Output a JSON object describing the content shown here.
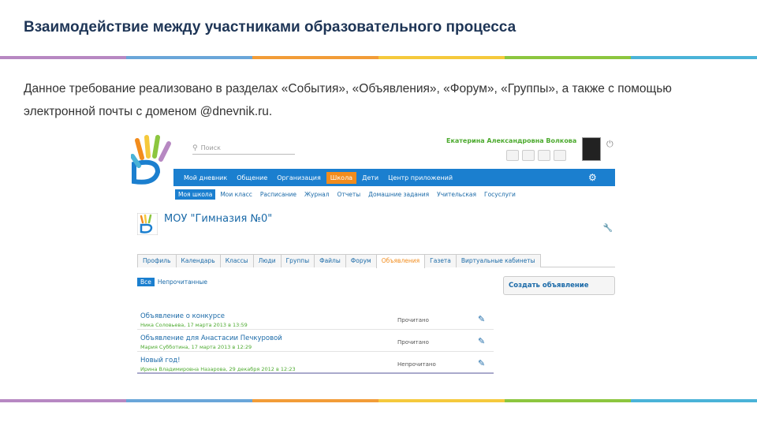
{
  "slide": {
    "title": "Взаимодействие между участниками образовательного процесса",
    "description": "Данное требование реализовано в разделах «События», «Объявления», «Форум», «Группы», а также с помощью электронной почты с доменом @dnevnik.ru.",
    "stripe_colors": [
      "#b788c2",
      "#6aa6d9",
      "#f29c38",
      "#f5c93c",
      "#8cc63f",
      "#4ab3d8"
    ]
  },
  "screenshot": {
    "search_placeholder": "Поиск",
    "user_name": "Екатерина Александровна Волкова",
    "nav": [
      "Мой дневник",
      "Общение",
      "Организация",
      "Школа",
      "Дети",
      "Центр приложений"
    ],
    "nav_active_index": 3,
    "subnav": [
      "Моя школа",
      "Мои класс",
      "Расписание",
      "Журнал",
      "Отчеты",
      "Домашние задания",
      "Учительская",
      "Госуслуги"
    ],
    "subnav_active_index": 0,
    "school_name": "МОУ \"Гимназия №0\"",
    "tabs": [
      "Профиль",
      "Календарь",
      "Классы",
      "Люди",
      "Группы",
      "Файлы",
      "Форум",
      "Объявления",
      "Газета",
      "Виртуальные кабинеты"
    ],
    "tabs_active_index": 7,
    "filter_all": "Все",
    "filter_unread": "Непрочитанные",
    "create_button": "Создать объявление",
    "announcements": [
      {
        "title": "Объявление о конкурсе",
        "meta": "Ника Соловьева, 17 марта 2013 в 13:59",
        "status": "Прочитано"
      },
      {
        "title": "Объявление для Анастасии Печкуровой",
        "meta": "Мария Субботина, 17 марта 2013 в 12:29",
        "status": "Прочитано"
      },
      {
        "title": "Новый год!",
        "meta": "Ирина Владимировна Назарова, 29 декабря 2012 в 12:23",
        "status": "Непрочитано"
      }
    ]
  }
}
